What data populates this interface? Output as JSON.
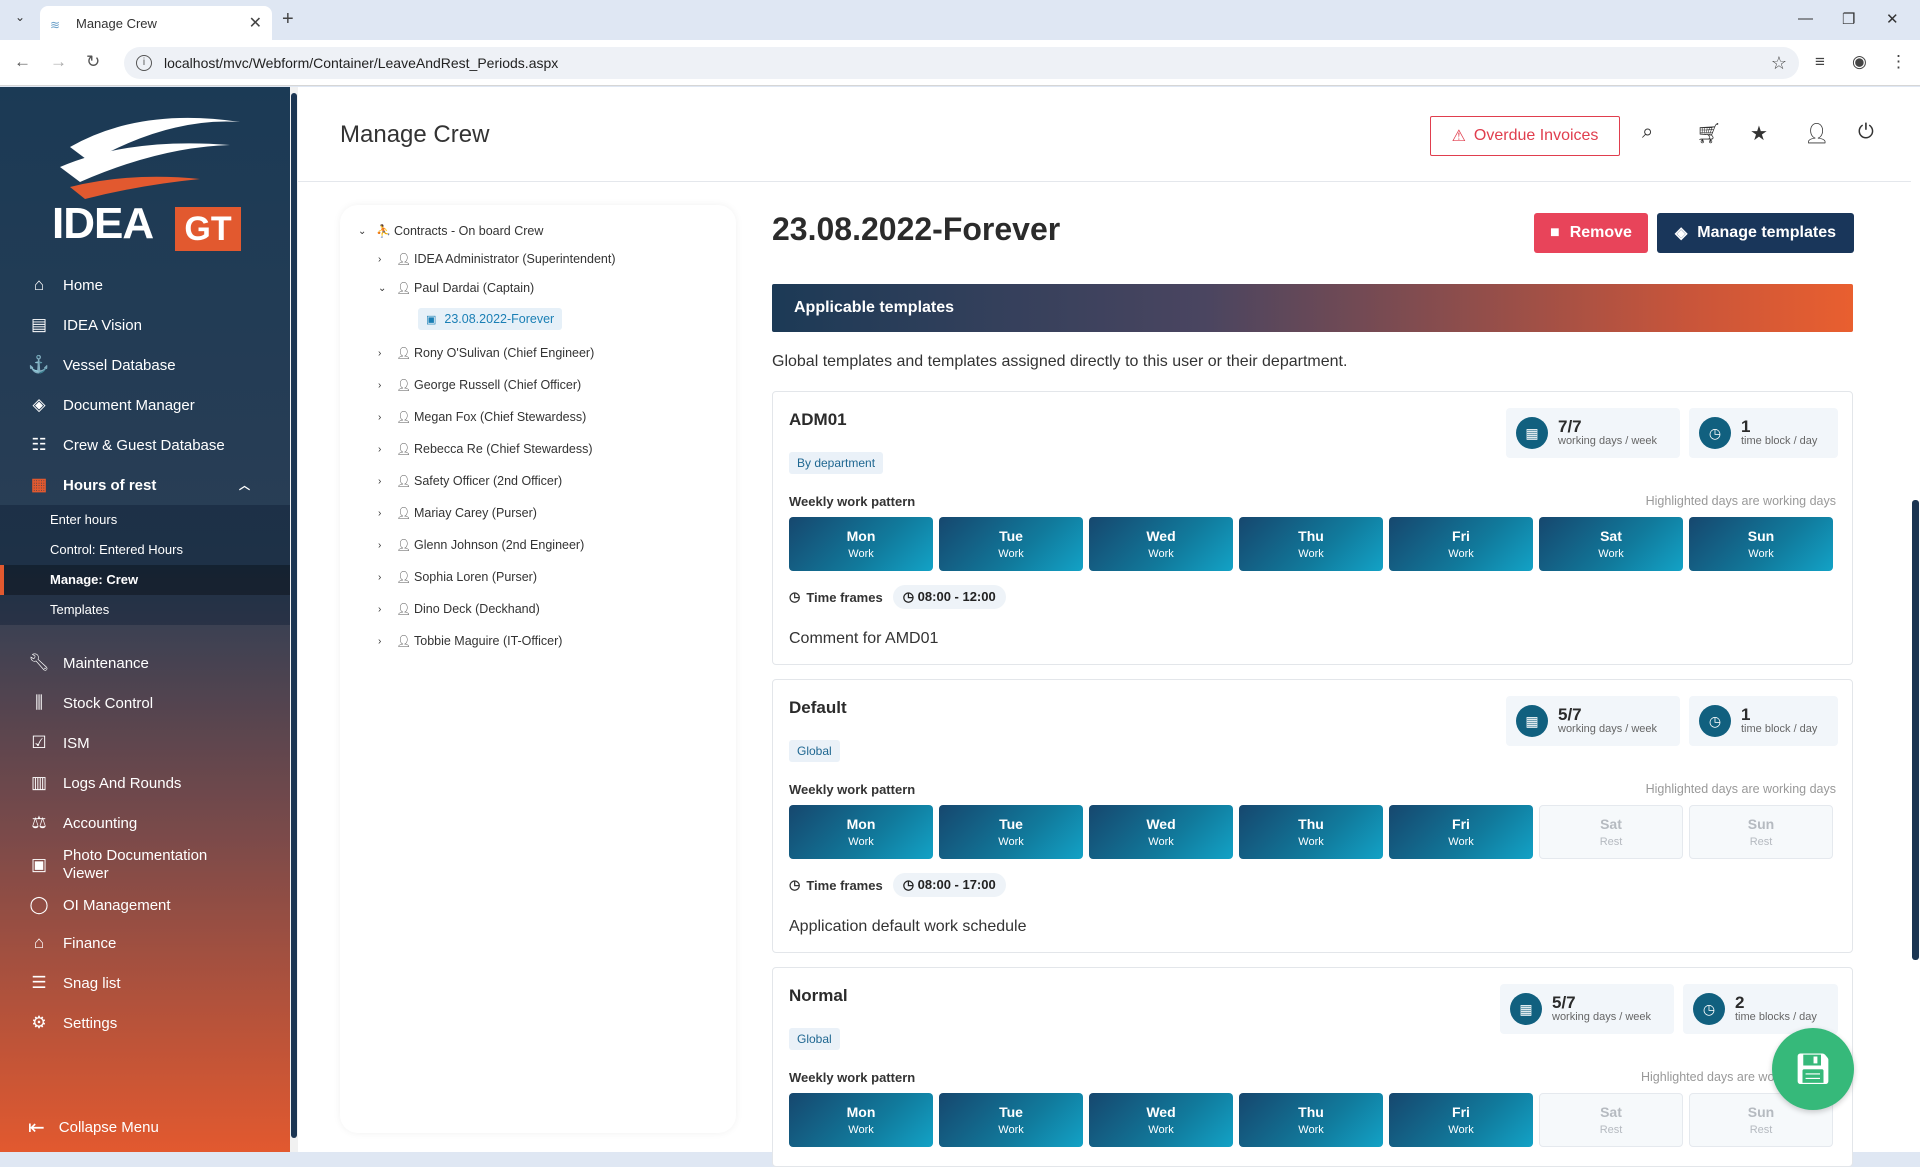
{
  "browser": {
    "tab_title": "Manage Crew",
    "url": "localhost/mvc/Webform/Container/LeaveAndRest_Periods.aspx"
  },
  "sidebar": {
    "logo_text": "IDEA",
    "logo_suffix": "GT",
    "items": [
      {
        "label": "Home",
        "icon": "home-icon"
      },
      {
        "label": "IDEA Vision",
        "icon": "clipboard-icon"
      },
      {
        "label": "Vessel Database",
        "icon": "anchor-icon"
      },
      {
        "label": "Document Manager",
        "icon": "layers-icon"
      },
      {
        "label": "Crew & Guest Database",
        "icon": "people-icon"
      },
      {
        "label": "Hours of rest",
        "icon": "calendar-icon"
      }
    ],
    "submenu": [
      {
        "label": "Enter hours"
      },
      {
        "label": "Control: Entered Hours"
      },
      {
        "label": "Manage: Crew"
      },
      {
        "label": "Templates"
      }
    ],
    "items2": [
      {
        "label": "Maintenance",
        "icon": "wrench-icon"
      },
      {
        "label": "Stock Control",
        "icon": "sliders-icon"
      },
      {
        "label": "ISM",
        "icon": "checklist-icon"
      },
      {
        "label": "Logs And Rounds",
        "icon": "log-icon"
      },
      {
        "label": "Accounting",
        "icon": "scale-icon"
      },
      {
        "label": "Photo Documentation Viewer",
        "icon": "photo-icon"
      },
      {
        "label": "OI Management",
        "icon": "lightbulb-icon"
      },
      {
        "label": "Finance",
        "icon": "bank-icon"
      },
      {
        "label": "Snag list",
        "icon": "list-icon"
      },
      {
        "label": "Settings",
        "icon": "gear-icon"
      }
    ],
    "collapse_label": "Collapse Menu"
  },
  "header": {
    "title": "Manage Crew",
    "overdue_label": "Overdue Invoices"
  },
  "tree": {
    "root": "Contracts - On board Crew",
    "members": [
      "IDEA Administrator (Superintendent)",
      "Paul Dardai (Captain)",
      "Rony O'Sulivan (Chief Engineer)",
      "George Russell (Chief Officer)",
      "Megan Fox (Chief Stewardess)",
      "Rebecca Re (Chief Stewardess)",
      "Safety Officer (2nd Officer)",
      "Mariay Carey (Purser)",
      "Glenn Johnson (2nd Engineer)",
      "Sophia Loren (Purser)",
      "Dino Deck (Deckhand)",
      "Tobbie Maguire (IT-Officer)"
    ],
    "selected_period": "23.08.2022-Forever"
  },
  "period": {
    "title": "23.08.2022-Forever",
    "remove_label": "Remove",
    "manage_label": "Manage templates",
    "applicable_title": "Applicable templates",
    "applicable_desc": "Global templates and templates assigned directly to this user or their department."
  },
  "labels": {
    "weekly": "Weekly work pattern",
    "hint": "Highlighted days are working days",
    "hint_cut": "Highlighted days are wo",
    "timeframes": "Time frames"
  },
  "templates": [
    {
      "name": "ADM01",
      "tag": "By department",
      "days_value": "7/7",
      "days_label": "working days / week",
      "blocks_value": "1",
      "blocks_label": "time block / day",
      "time_frame": "08:00 - 12:00",
      "comment": "Comment for AMD01",
      "days": [
        {
          "d": "Mon",
          "s": "Work",
          "work": true
        },
        {
          "d": "Tue",
          "s": "Work",
          "work": true
        },
        {
          "d": "Wed",
          "s": "Work",
          "work": true
        },
        {
          "d": "Thu",
          "s": "Work",
          "work": true
        },
        {
          "d": "Fri",
          "s": "Work",
          "work": true
        },
        {
          "d": "Sat",
          "s": "Work",
          "work": true
        },
        {
          "d": "Sun",
          "s": "Work",
          "work": true
        }
      ]
    },
    {
      "name": "Default",
      "tag": "Global",
      "days_value": "5/7",
      "days_label": "working days / week",
      "blocks_value": "1",
      "blocks_label": "time block / day",
      "time_frame": "08:00 - 17:00",
      "comment": "Application default work schedule",
      "days": [
        {
          "d": "Mon",
          "s": "Work",
          "work": true
        },
        {
          "d": "Tue",
          "s": "Work",
          "work": true
        },
        {
          "d": "Wed",
          "s": "Work",
          "work": true
        },
        {
          "d": "Thu",
          "s": "Work",
          "work": true
        },
        {
          "d": "Fri",
          "s": "Work",
          "work": true
        },
        {
          "d": "Sat",
          "s": "Rest",
          "work": false
        },
        {
          "d": "Sun",
          "s": "Rest",
          "work": false
        }
      ]
    },
    {
      "name": "Normal",
      "tag": "Global",
      "days_value": "5/7",
      "days_label": "working days / week",
      "blocks_value": "2",
      "blocks_label": "time blocks / day",
      "days": [
        {
          "d": "Mon",
          "s": "Work",
          "work": true
        },
        {
          "d": "Tue",
          "s": "Work",
          "work": true
        },
        {
          "d": "Wed",
          "s": "Work",
          "work": true
        },
        {
          "d": "Thu",
          "s": "Work",
          "work": true
        },
        {
          "d": "Fri",
          "s": "Work",
          "work": true
        },
        {
          "d": "Sat",
          "s": "Rest",
          "work": false
        },
        {
          "d": "Sun",
          "s": "Rest",
          "work": false
        }
      ]
    }
  ],
  "colors": {
    "accent": "#e2592f",
    "navy": "#19365a",
    "danger": "#e8445a",
    "teal": "#11607f",
    "save": "#36b97a"
  }
}
